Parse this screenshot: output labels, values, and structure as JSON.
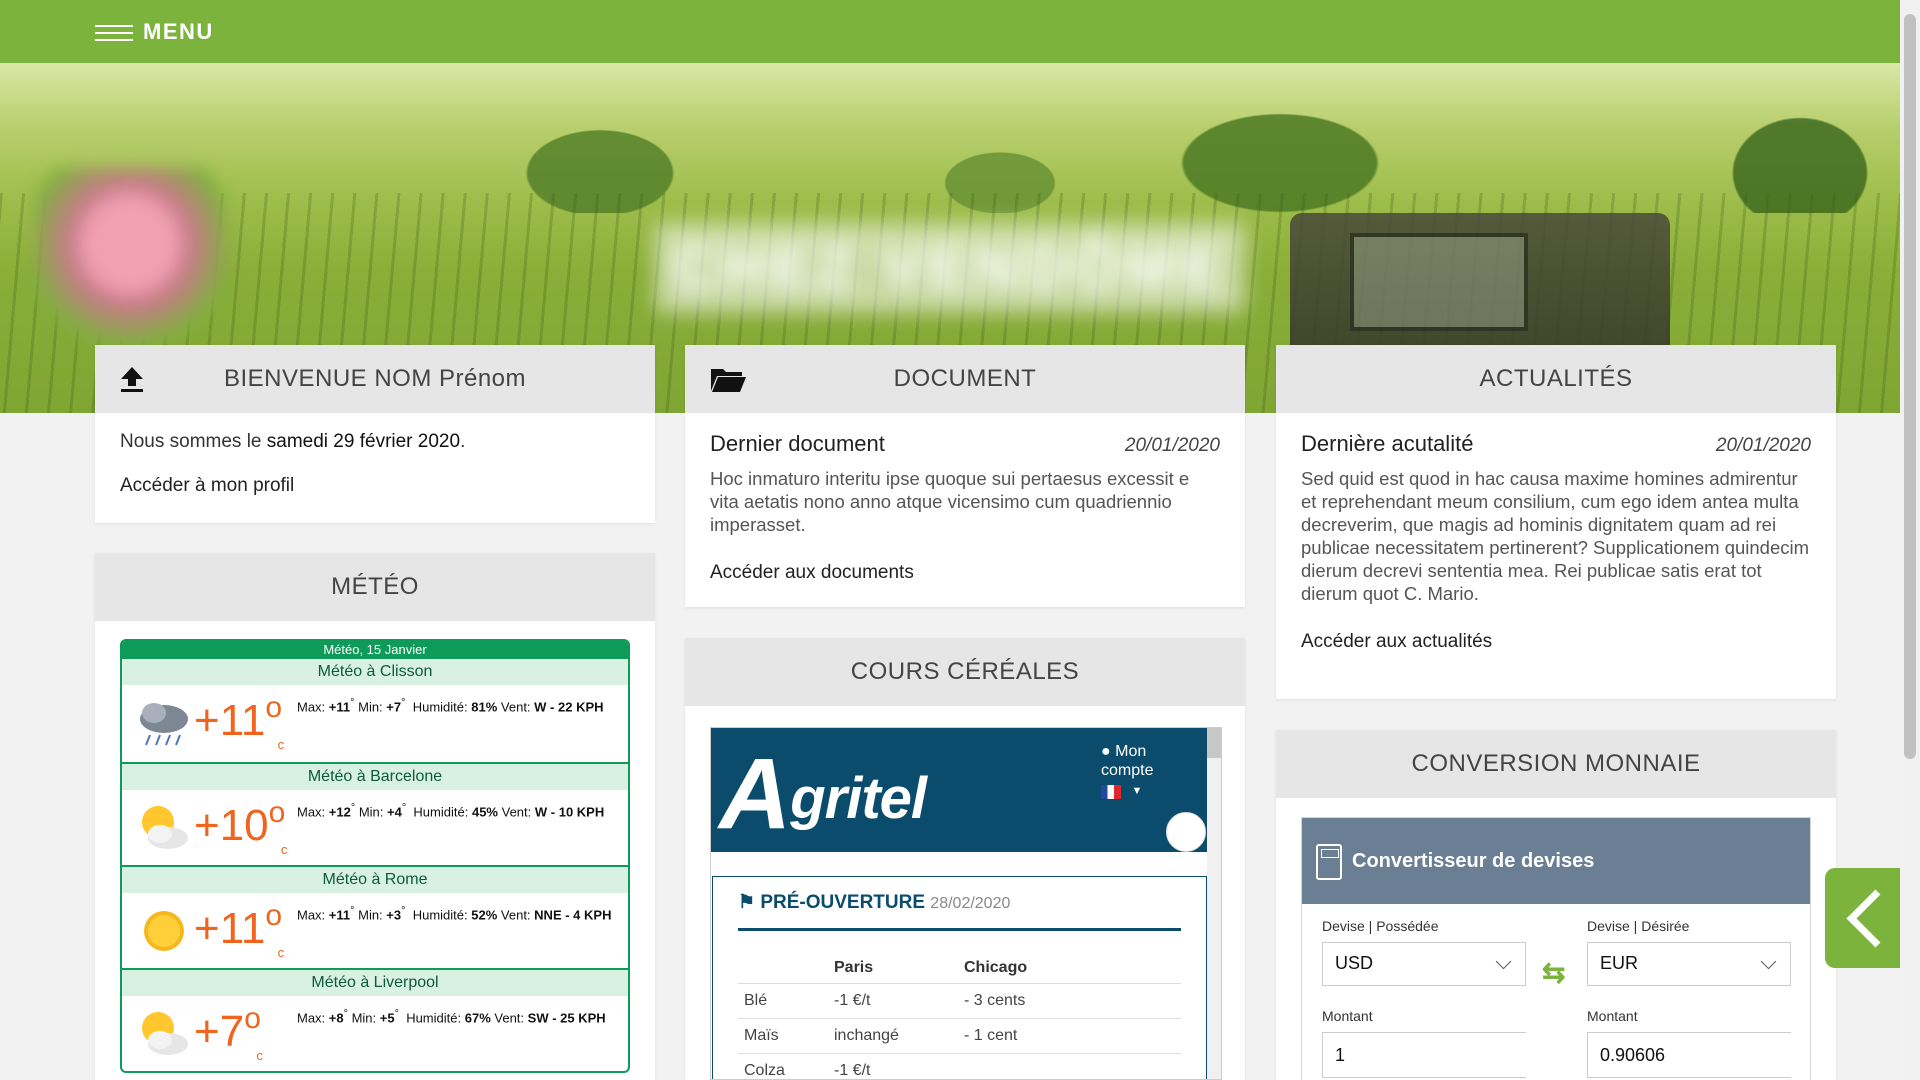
{
  "header": {
    "menu_label": "MENU"
  },
  "hero": {
    "site_title": "CHEZ VENDÔME"
  },
  "welcome": {
    "title": "BIENVENUE NOM Prénom",
    "date_prefix": "Nous sommes le ",
    "date": "samedi 29 février 2020",
    "date_suffix": ".",
    "profile_link": "Accéder à mon profil"
  },
  "meteo": {
    "title": "MÉTÉO",
    "widget_header": "Météo, 15 Janvier",
    "cities": [
      {
        "name": "Météo à Clisson",
        "icon": "rain-cloud-icon",
        "sign": "+",
        "temp": "11",
        "max": "+11",
        "min": "+7",
        "humidity": "81%",
        "wind": "W - 22 KPH"
      },
      {
        "name": "Météo à Barcelone",
        "icon": "partly-cloudy-icon",
        "sign": "+",
        "temp": "10",
        "max": "+12",
        "min": "+4",
        "humidity": "45%",
        "wind": "W - 10 KPH"
      },
      {
        "name": "Météo à Rome",
        "icon": "sun-icon",
        "sign": "+",
        "temp": "11",
        "max": "+11",
        "min": "+3",
        "humidity": "52%",
        "wind": "NNE - 4 KPH"
      },
      {
        "name": "Météo à Liverpool",
        "icon": "partly-cloudy-icon",
        "sign": "+",
        "temp": "7",
        "max": "+8",
        "min": "+5",
        "humidity": "67%",
        "wind": "SW - 25 KPH"
      }
    ],
    "labels": {
      "max": "Max:",
      "min": "Min:",
      "humidity": "Humidité:",
      "wind": "Vent:",
      "degree": "o",
      "unit": "c",
      "deg_small": "°"
    }
  },
  "document": {
    "title": "DOCUMENT",
    "item_title": "Dernier document",
    "item_date": "20/01/2020",
    "item_text": "Hoc inmaturo interitu ipse quoque sui pertaesus excessit e vita aetatis nono anno atque vicensimo cum quadriennio imperasset.",
    "link": "Accéder aux documents"
  },
  "cereales": {
    "title": "COURS CÉRÉALES",
    "agritel": {
      "logo_big": "A",
      "logo_rest": "gritel",
      "account_line1": "Mon",
      "account_line2": "compte",
      "panel_title": "PRÉ-OUVERTURE",
      "panel_date": "28/02/2020",
      "columns": [
        "",
        "Paris",
        "Chicago"
      ],
      "rows": [
        [
          "Blé",
          "-1 €/t",
          "- 3 cents"
        ],
        [
          "Maïs",
          "inchangé",
          "- 1 cent"
        ],
        [
          "Colza",
          "-1 €/t",
          ""
        ]
      ]
    }
  },
  "actus": {
    "title": "ACTUALITÉS",
    "item_title": "Dernière acutalité",
    "item_date": "20/01/2020",
    "item_text": "Sed quid est quod in hac causa maxime homines admirentur et reprehendant meum consilium, cum ego idem antea multa decreverim, que magis ad hominis dignitatem quam ad rei publicae necessitatem pertinerent? Supplicationem quindecim dierum decrevi sententia mea. Rei publicae satis erat tot dierum quot C. Mario.",
    "link": "Accéder aux actualités"
  },
  "monnaie": {
    "title": "CONVERSION MONNAIE",
    "widget_title": "Convertisseur de devises",
    "from_label": "Devise | Possédée",
    "to_label": "Devise | Désirée",
    "from_value": "USD",
    "to_value": "EUR",
    "amount_label": "Montant",
    "amount_from": "1",
    "amount_to": "0.90606"
  },
  "colors": {
    "green": "#7cb33c",
    "meteo_green": "#0e9b5a",
    "agritel_blue": "#0b4c6d",
    "converter_header": "#6a7f94",
    "temp_orange": "#f0641e"
  }
}
